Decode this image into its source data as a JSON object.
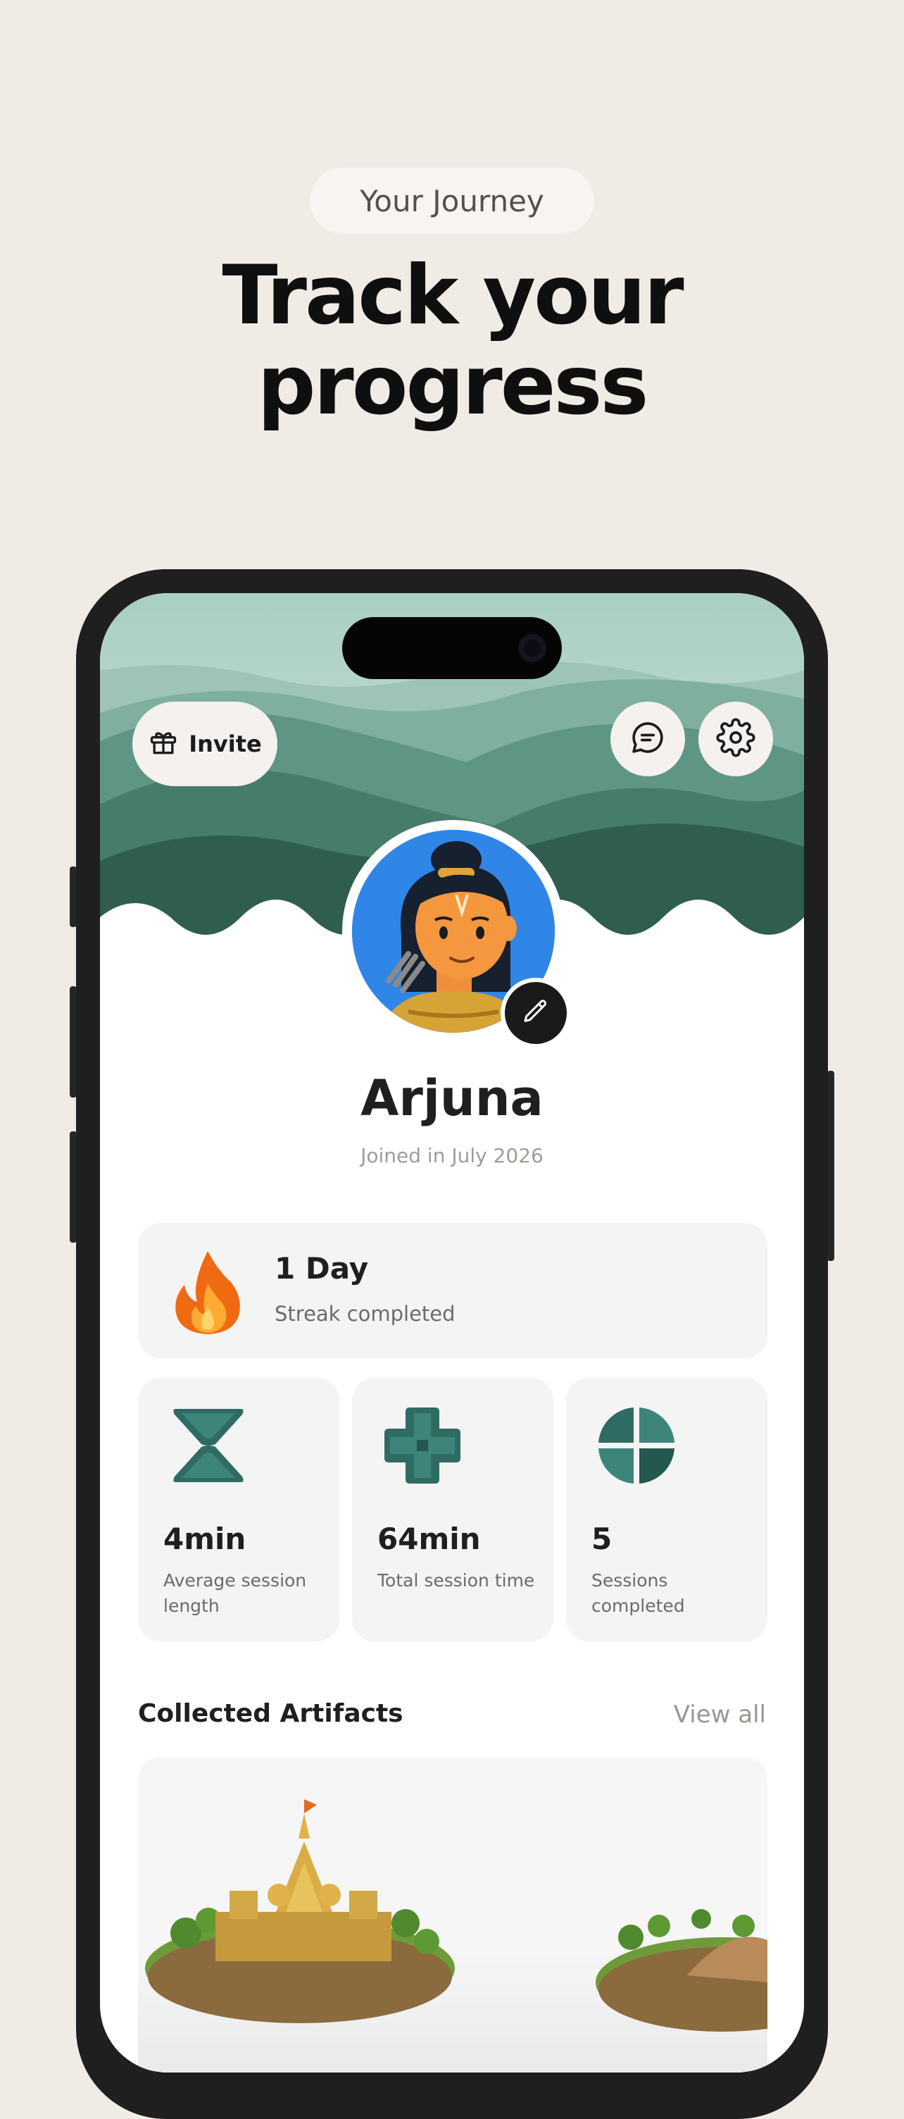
{
  "header": {
    "pill_label": "Your Journey",
    "headline_line1": "Track your",
    "headline_line2": "progress"
  },
  "profile": {
    "invite_label": "Invite",
    "name": "Arjuna",
    "joined": "Joined in July 2026"
  },
  "streak": {
    "value": "1 Day",
    "label": "Streak completed"
  },
  "stats": [
    {
      "value": "4min",
      "label": "Average session length",
      "icon": "hourglass-icon"
    },
    {
      "value": "64min",
      "label": "Total session time",
      "icon": "plus-shape-icon"
    },
    {
      "value": "5",
      "label": "Sessions completed",
      "icon": "quarter-circle-icon"
    }
  ],
  "artifacts": {
    "title": "Collected Artifacts",
    "view_all": "View all"
  },
  "colors": {
    "background": "#f1ebe6",
    "accent_teal": "#2f6b63",
    "avatar_bg": "#2f86e6"
  }
}
